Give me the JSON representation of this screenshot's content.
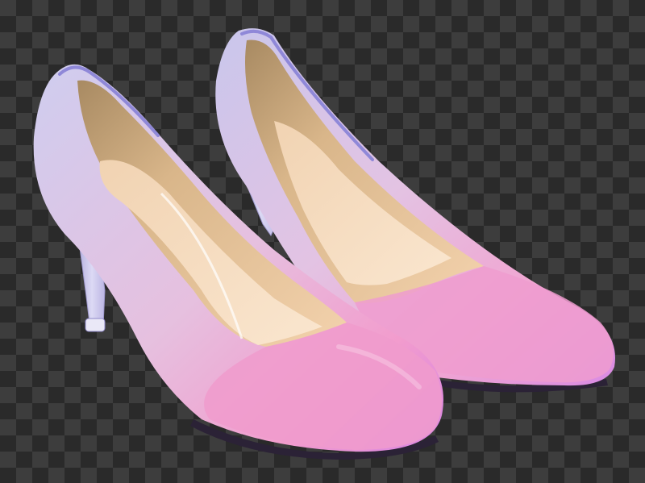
{
  "image": {
    "subject": "pair-of-pointed-toe-high-heel-pumps",
    "background": "transparency-checkerboard",
    "colors": {
      "checker_light": "#3d3d3d",
      "checker_dark": "#2a2a2a",
      "shoe_heel_lilac": "#c9c6ec",
      "shoe_mid_mauve": "#e3b9dd",
      "shoe_toe_pink": "#ef93cf",
      "shoe_toe_violet": "#d886e6",
      "lining_tan": "#e8c59a",
      "insole_cream": "#f6dcbd",
      "collar_edge_purple": "#8f88d8",
      "sole_dark": "#2b2236"
    }
  }
}
